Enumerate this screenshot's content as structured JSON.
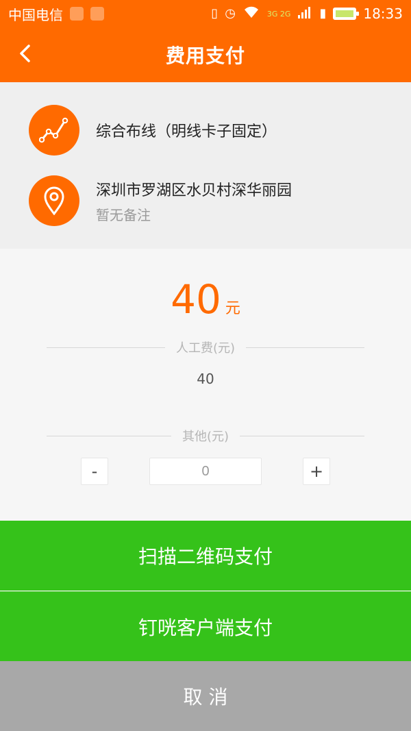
{
  "status_bar": {
    "carrier": "中国电信",
    "network": "3G 2G",
    "time": "18:33",
    "icons": [
      "location-icon",
      "android-icon",
      "vibrate-icon",
      "alarm-icon",
      "wifi-icon",
      "signal-icon",
      "sim-icon",
      "battery-icon"
    ]
  },
  "header": {
    "back_icon": "chevron-left-icon",
    "title": "费用支付"
  },
  "info": {
    "service": {
      "icon": "line-chart-icon",
      "name": "综合布线（明线卡子固定）"
    },
    "address": {
      "icon": "map-pin-icon",
      "text": "深圳市罗湖区水贝村深华丽园",
      "note": "暂无备注"
    }
  },
  "amount": {
    "value": "40",
    "unit": "元"
  },
  "labor": {
    "label": "人工费(元)",
    "value": "40"
  },
  "other": {
    "label": "其他(元)",
    "minus_label": "-",
    "plus_label": "+",
    "input_value": "0"
  },
  "actions": {
    "scan_qr": "扫描二维码支付",
    "client_pay": "钉咣客户端支付",
    "cancel": "取 消"
  },
  "colors": {
    "accent": "#ff6a00",
    "green": "#35c21a",
    "gray": "#a8a8a8"
  }
}
